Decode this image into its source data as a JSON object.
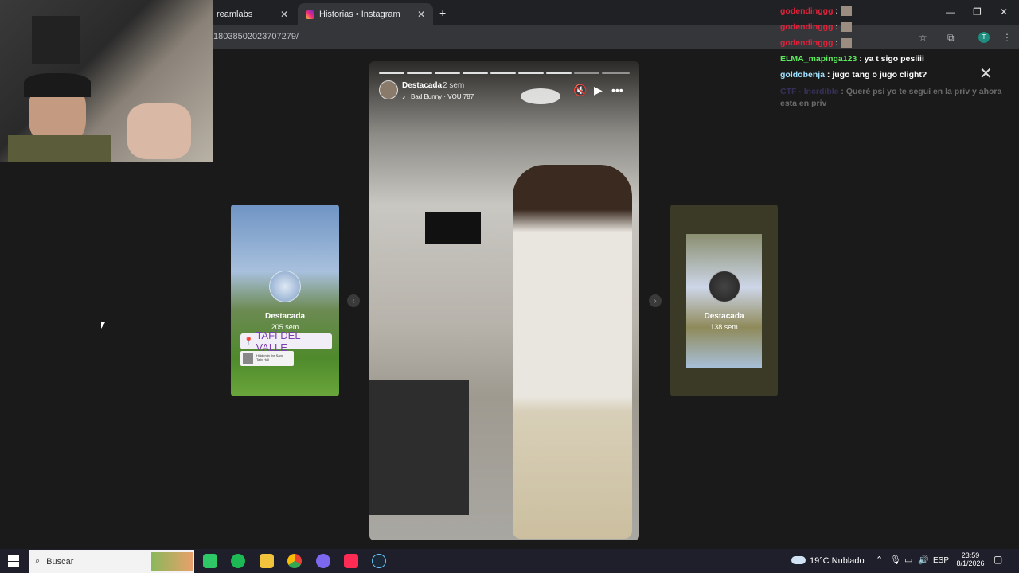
{
  "browser": {
    "tabs": [
      {
        "label": "reamlabs",
        "close": "✕"
      },
      {
        "label": "Historias • Instagram",
        "close": "✕"
      }
    ],
    "new_tab": "+",
    "url": "18038502023707279/",
    "window_controls": [
      "—",
      "❐",
      "✕"
    ]
  },
  "stories": {
    "left": {
      "title": "Destacada",
      "time": "205 sem",
      "location": "TAFÍ DEL VALLE",
      "music_line1": "Hidden in the Sand",
      "music_line2": "Tally Hall"
    },
    "main": {
      "title": "Destacada",
      "time": "2 sem",
      "song": "Bad Bunny · VOU 787",
      "progress_segments": 9
    },
    "right": {
      "title": "Destacada",
      "time": "138 sem"
    }
  },
  "chat": {
    "lines": [
      {
        "user": "godendinggg",
        "text": ":",
        "color": "#e0223b",
        "thumb": true
      },
      {
        "user": "godendinggg",
        "text": ":",
        "color": "#e0223b",
        "thumb": true
      },
      {
        "user": "godendinggg",
        "text": ":",
        "color": "#e0223b",
        "thumb": true
      },
      {
        "user": "ELMA_mapinga123",
        "text": ": ya t sigo pesiiii",
        "color": "#5ee85e"
      },
      {
        "user": "goldobenja",
        "text": ": jugo tang o jugo clight?",
        "color": "#9fe0ff"
      },
      {
        "user": "CTF · Incrdible",
        "text": ": Queré psí yo te seguí en la priv y ahora esta en priv",
        "color": "#6a5acd"
      }
    ]
  },
  "taskbar": {
    "search_placeholder": "Buscar",
    "weather": "19°C  Nublado",
    "lang": "ESP",
    "time": "23:59",
    "date": "8/1/2026"
  }
}
